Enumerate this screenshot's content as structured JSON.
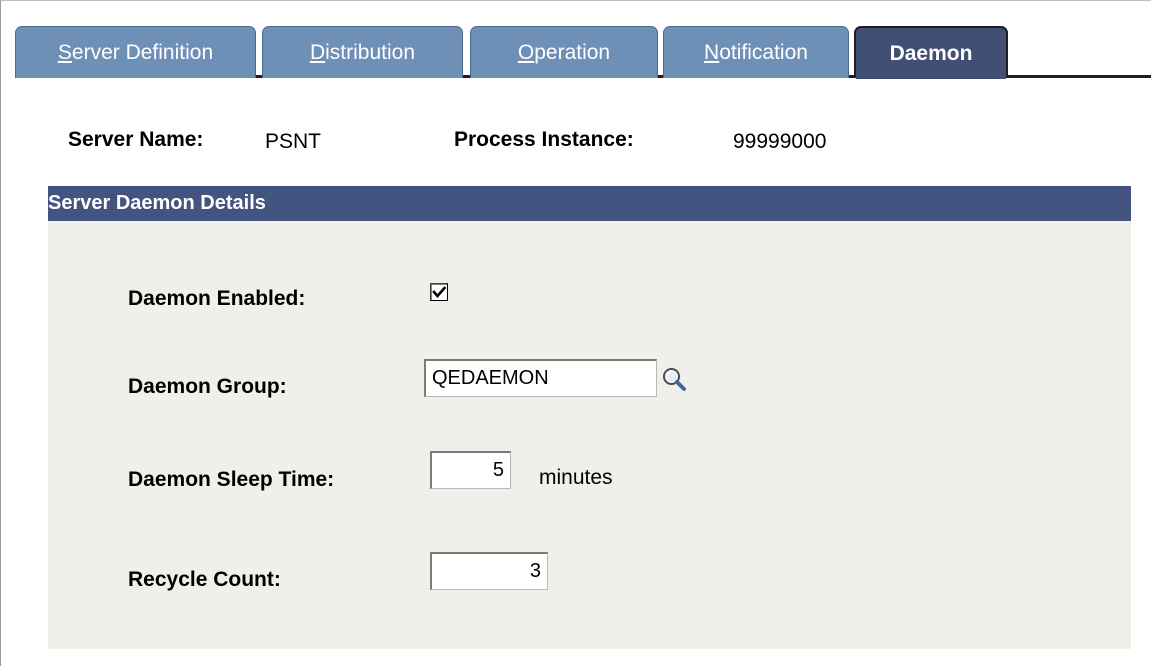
{
  "tabs": [
    {
      "pre": "",
      "key": "S",
      "rest": "erver Definition",
      "active": false
    },
    {
      "pre": "",
      "key": "D",
      "rest": "istribution",
      "active": false
    },
    {
      "pre": "",
      "key": "O",
      "rest": "peration",
      "active": false
    },
    {
      "pre": "",
      "key": "N",
      "rest": "otification",
      "active": false
    },
    {
      "pre": "",
      "key": "",
      "rest": "Daemon",
      "active": true
    }
  ],
  "header": {
    "server_name_label": "Server Name:",
    "server_name_value": "PSNT",
    "process_instance_label": "Process Instance:",
    "process_instance_value": "99999000"
  },
  "group": {
    "title": "Server Daemon Details",
    "daemon_enabled_label": "Daemon Enabled:",
    "daemon_enabled_checked": true,
    "daemon_group_label": "Daemon Group:",
    "daemon_group_value": "QEDAEMON",
    "sleep_time_label": "Daemon Sleep Time:",
    "sleep_time_value": "5",
    "sleep_time_unit": "minutes",
    "recycle_count_label": "Recycle Count:",
    "recycle_count_value": "3"
  },
  "icons": {
    "lookup": "magnifier-icon",
    "checkbox": "checkmark-icon"
  },
  "colors": {
    "tab_inactive": "#6e8fb6",
    "tab_active": "#414f74",
    "group_header": "#445480",
    "group_body": "#f0f0ea"
  }
}
